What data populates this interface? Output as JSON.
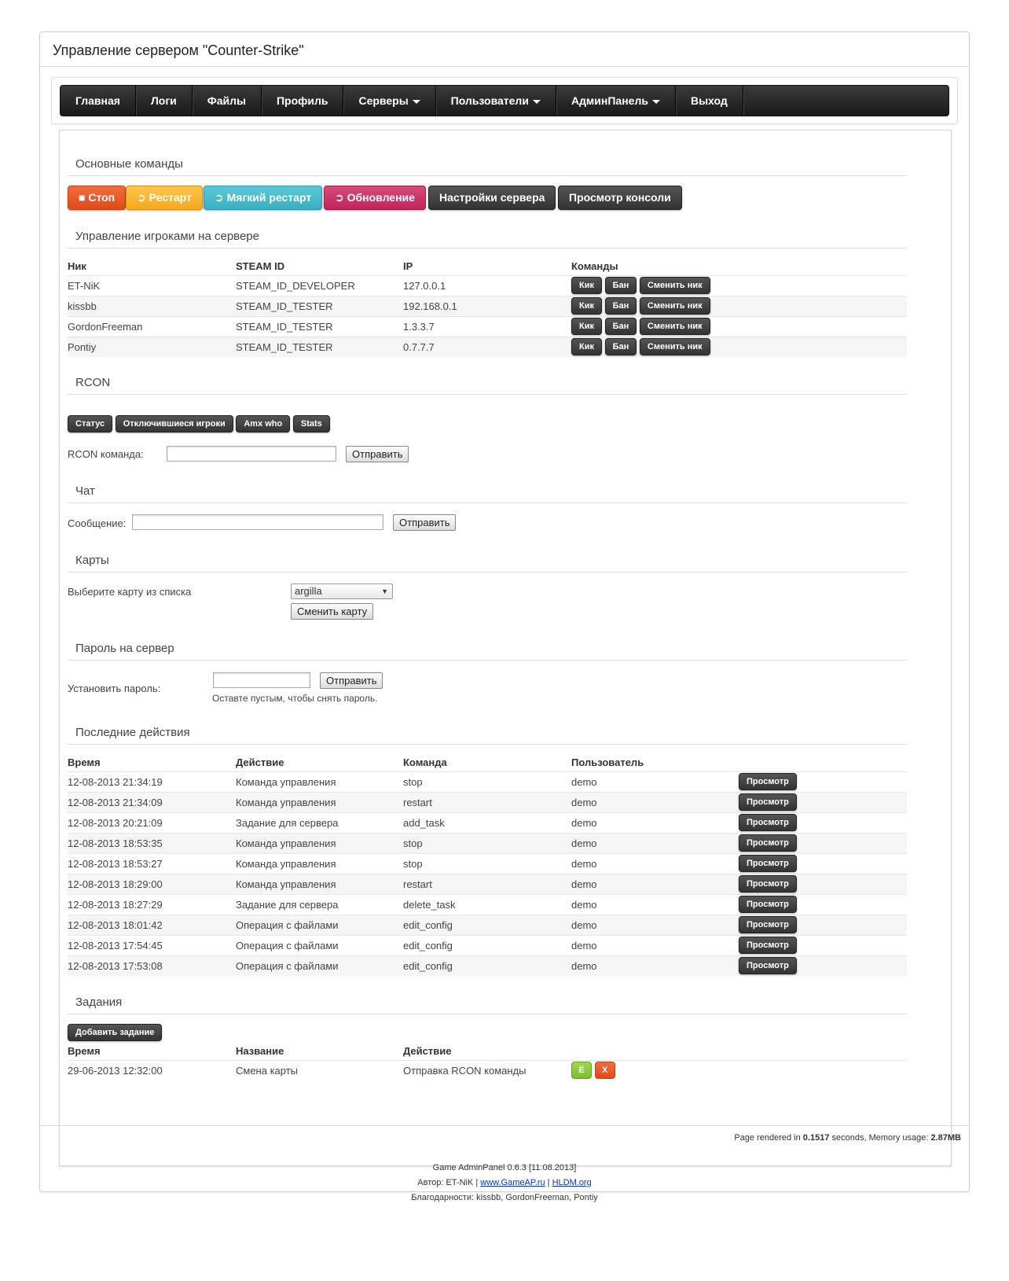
{
  "title": "Управление сервером \"Counter-Strike\"",
  "nav": {
    "items": [
      {
        "label": "Главная",
        "dropdown": false
      },
      {
        "label": "Логи",
        "dropdown": false
      },
      {
        "label": "Файлы",
        "dropdown": false
      },
      {
        "label": "Профиль",
        "dropdown": false
      },
      {
        "label": "Серверы",
        "dropdown": true
      },
      {
        "label": "Пользователи",
        "dropdown": true
      },
      {
        "label": "АдминПанель",
        "dropdown": true
      },
      {
        "label": "Выход",
        "dropdown": false
      }
    ]
  },
  "main_commands": {
    "heading": "Основные команды",
    "buttons": {
      "stop": "■ Стоп",
      "restart": "➲ Рестарт",
      "soft_restart": "➲ Мягкий рестарт",
      "update": "➲ Обновление",
      "settings": "Настройки сервера",
      "console": "Просмотр консоли"
    }
  },
  "players": {
    "heading": "Управление игроками на сервере",
    "columns": [
      "Ник",
      "STEAM ID",
      "IP",
      "Команды"
    ],
    "kick_label": "Кик",
    "ban_label": "Бан",
    "rename_label": "Сменить ник",
    "rows": [
      [
        "ET-NiK",
        "STEAM_ID_DEVELOPER",
        "127.0.0.1"
      ],
      [
        "kissbb",
        "STEAM_ID_TESTER",
        "192.168.0.1"
      ],
      [
        "GordonFreeman",
        "STEAM_ID_TESTER",
        "1.3.3.7"
      ],
      [
        "Pontiy",
        "STEAM_ID_TESTER",
        "0.7.7.7"
      ]
    ]
  },
  "rcon": {
    "heading": "RCON",
    "buttons": [
      "Статус",
      "Отключившиеся игроки",
      "Amx who",
      "Stats"
    ],
    "label": "RCON команда:",
    "send": "Отправить"
  },
  "chat": {
    "heading": "Чат",
    "label": "Сообщение:",
    "send": "Отправить"
  },
  "maps": {
    "heading": "Карты",
    "label": "Выберите карту из списка",
    "selected": "argilla",
    "change": "Сменить карту"
  },
  "password": {
    "heading": "Пароль на сервер",
    "label": "Установить пароль:",
    "send": "Отправить",
    "hint": "Оставте пустым, чтобы снять пароль."
  },
  "actions": {
    "heading": "Последние действия",
    "columns": [
      "Время",
      "Действие",
      "Команда",
      "Пользователь"
    ],
    "view_label": "Просмотр",
    "rows": [
      [
        "12-08-2013 21:34:19",
        "Команда управления",
        "stop",
        "demo"
      ],
      [
        "12-08-2013 21:34:09",
        "Команда управления",
        "restart",
        "demo"
      ],
      [
        "12-08-2013 20:21:09",
        "Задание для сервера",
        "add_task",
        "demo"
      ],
      [
        "12-08-2013 18:53:35",
        "Команда управления",
        "stop",
        "demo"
      ],
      [
        "12-08-2013 18:53:27",
        "Команда управления",
        "stop",
        "demo"
      ],
      [
        "12-08-2013 18:29:00",
        "Команда управления",
        "restart",
        "demo"
      ],
      [
        "12-08-2013 18:27:29",
        "Задание для сервера",
        "delete_task",
        "demo"
      ],
      [
        "12-08-2013 18:01:42",
        "Операция с файлами",
        "edit_config",
        "demo"
      ],
      [
        "12-08-2013 17:54:45",
        "Операция с файлами",
        "edit_config",
        "demo"
      ],
      [
        "12-08-2013 17:53:08",
        "Операция с файлами",
        "edit_config",
        "demo"
      ]
    ]
  },
  "tasks": {
    "heading": "Задания",
    "add": "Добавить задание",
    "columns": [
      "Время",
      "Название",
      "Действие"
    ],
    "rows": [
      {
        "time": "29-06-2013 12:32:00",
        "name": "Смена карты",
        "action": "Отправка RCON команды",
        "edit": "E",
        "delete": "X"
      }
    ]
  },
  "footer": {
    "render_prefix": "Page rendered in ",
    "render_time": "0.1517",
    "render_mid": " seconds, Memory usage: ",
    "memory": "2.87MB",
    "version": "Game AdminPanel 0.6.3 [11.08.2013]",
    "author_prefix": "Автор: ET-NiK | ",
    "link1": "www.GameAP.ru",
    "sep": " | ",
    "link2": "HLDM.org",
    "thanks": "Благодарности: kissbb, GordonFreeman, Pontiy"
  }
}
